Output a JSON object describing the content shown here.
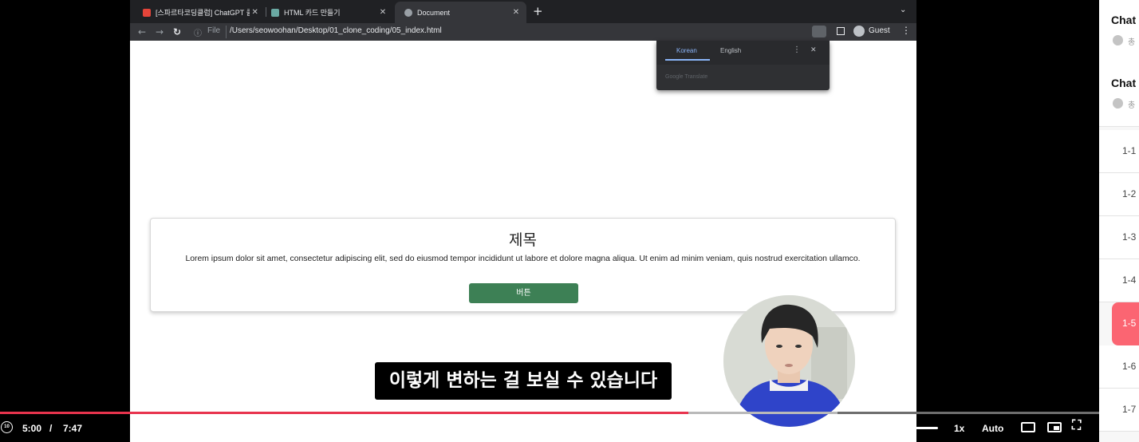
{
  "browser": {
    "tabs": [
      {
        "title": "[스파르타코딩클럽] ChatGPT 클론",
        "favicon_color": "#e5453a"
      },
      {
        "title": "HTML 카드 만들기",
        "favicon_color": "#6aa9a3"
      },
      {
        "title": "Document",
        "favicon_color": "#9aa0a6"
      }
    ],
    "new_tab": "+",
    "omnibox": {
      "scheme_label": "File",
      "url": "/Users/seowoohan/Desktop/01_clone_coding/05_index.html"
    },
    "profile_label": "Guest"
  },
  "translate_popup": {
    "tabs": [
      "Korean",
      "English"
    ],
    "brand": "Google Translate"
  },
  "page": {
    "card_title": "제목",
    "card_text": "Lorem ipsum dolor sit amet, consectetur adipiscing elit, sed do eiusmod tempor incididunt ut labore et dolore magna aliqua. Ut enim ad minim veniam, quis nostrud exercitation ullamco.",
    "card_button": "버튼",
    "button_color": "#3d8055"
  },
  "subtitle": "이렇게 변하는 걸 보실 수 있습니다",
  "player": {
    "current_time": "5:00",
    "separator": "/",
    "duration": "7:47",
    "progress_fraction": 0.626,
    "buffered_fraction": 0.762,
    "speed": "1x",
    "quality": "Auto",
    "accent_color": "#e8344e"
  },
  "sidebar": {
    "headers": [
      {
        "title": "Chat",
        "sub": "총"
      },
      {
        "title": "Chat",
        "sub": "총"
      }
    ],
    "items": [
      "1-1",
      "1-2",
      "1-3",
      "1-4",
      "1-5",
      "1-6",
      "1-7"
    ],
    "active_index": 4,
    "active_color": "#fb6572"
  }
}
